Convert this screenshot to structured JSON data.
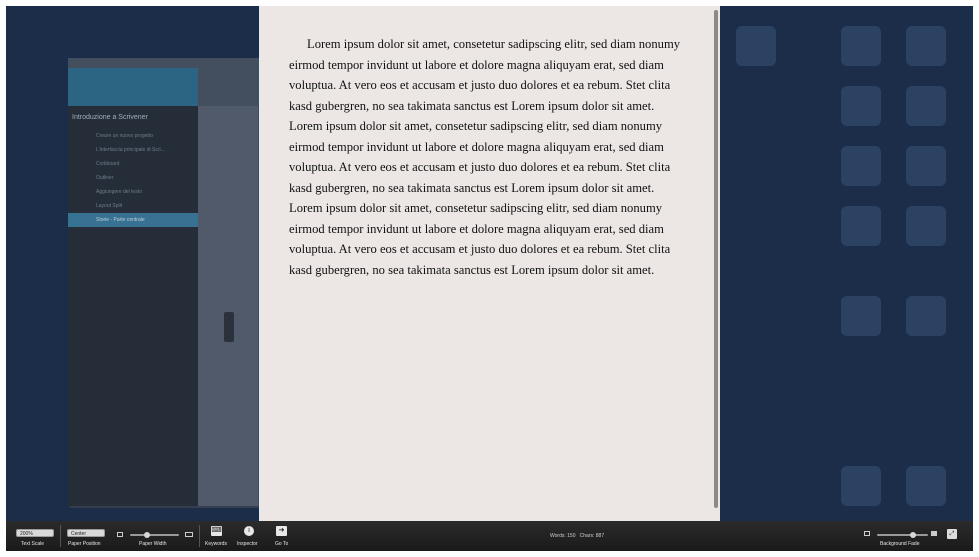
{
  "document": {
    "text": "Lorem ipsum dolor sit amet, consetetur sadipscing elitr, sed diam nonumy eirmod tempor invidunt ut labore et dolore magna aliquyam erat, sed diam voluptua. At vero eos et accusam et justo duo dolores et ea rebum. Stet clita kasd gubergren, no sea takimata sanctus est Lorem ipsum dolor sit amet. Lorem ipsum dolor sit amet, consetetur sadipscing elitr, sed diam nonumy eirmod tempor invidunt ut labore et dolore magna aliquyam erat, sed diam voluptua. At vero eos et accusam et justo duo dolores et ea rebum. Stet clita kasd gubergren, no sea takimata sanctus est Lorem ipsum dolor sit amet. Lorem ipsum dolor sit amet, consetetur sadipscing elitr, sed diam nonumy eirmod tempor invidunt ut labore et dolore magna aliquyam erat, sed diam voluptua. At vero eos et accusam et justo duo dolores et ea rebum. Stet clita kasd gubergren, no sea takimata sanctus est Lorem ipsum dolor sit amet."
  },
  "background_window": {
    "binder_title": "Introduzione a Scrivener",
    "binder_items": [
      "Creare un nuovo progetto",
      "L'interfaccia principale di Scri...",
      "Corkboard",
      "Outliner",
      "Aggiungere del testo",
      "Layout Split",
      "Storie - Parte centrale"
    ]
  },
  "toolbar": {
    "text_scale_value": "200%",
    "text_scale_label": "Text Scale",
    "paper_position_value": "Center",
    "paper_position_label": "Paper Position",
    "paper_width_label": "Paper Width",
    "keywords_label": "Keywords",
    "inspector_label": "Inspector",
    "goto_label": "Go To",
    "words_label": "Words: 150",
    "chars_label": "Chars: 887",
    "background_fade_label": "Background Fade"
  },
  "sliders": {
    "paper_width_level": 0.35,
    "background_fade_level": 0.7
  },
  "icons": {
    "keywords": "keywords-icon",
    "inspector": "info-icon",
    "goto": "goto-icon",
    "expand": "fullscreen-icon"
  }
}
